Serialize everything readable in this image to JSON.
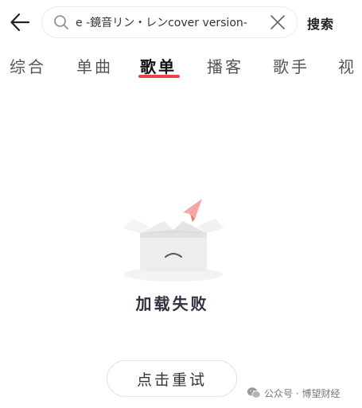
{
  "header": {
    "search_value": "e -鏡音リン・レンcover version-",
    "search_button_label": "搜索"
  },
  "tabs": [
    {
      "label": "综合",
      "active": false
    },
    {
      "label": "单曲",
      "active": false
    },
    {
      "label": "歌单",
      "active": true
    },
    {
      "label": "播客",
      "active": false
    },
    {
      "label": "歌手",
      "active": false
    },
    {
      "label": "视",
      "active": false
    }
  ],
  "empty_state": {
    "message": "加载失败",
    "retry_label": "点击重试",
    "illustration": "empty-box-with-paper-plane"
  },
  "watermark": {
    "text": "公众号 · 博望财经",
    "icon": "wechat-icon"
  },
  "colors": {
    "accent": "#e8454a",
    "text_primary": "#222222",
    "text_secondary": "#555555",
    "empty_text": "#2f3240"
  },
  "icons": {
    "back": "arrow-left-icon",
    "search": "search-icon",
    "clear": "close-icon"
  }
}
